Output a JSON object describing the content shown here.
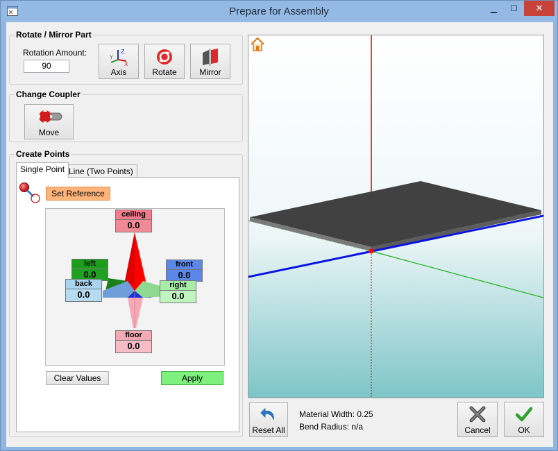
{
  "window": {
    "title": "Prepare for Assembly",
    "minimize_glyph": "▁",
    "maximize_glyph": "☐",
    "close_glyph": "✕"
  },
  "rotate_mirror": {
    "title": "Rotate / Mirror Part",
    "rotation_label": "Rotation Amount:",
    "rotation_value": "90",
    "axis_label": "Axis",
    "rotate_label": "Rotate",
    "mirror_label": "Mirror",
    "axis_letters": {
      "x": "X",
      "y": "Y",
      "z": "Z"
    }
  },
  "coupler": {
    "title": "Change Coupler",
    "move_label": "Move"
  },
  "create_points": {
    "title": "Create Points",
    "tabs": [
      {
        "label": "Single Point",
        "active": true
      },
      {
        "label": "Line (Two Points)",
        "active": false
      }
    ],
    "set_reference_label": "Set Reference",
    "directions": {
      "ceiling": {
        "label": "ceiling",
        "value": "0.0"
      },
      "left": {
        "label": "left",
        "value": "0.0"
      },
      "front": {
        "label": "front",
        "value": "0.0"
      },
      "back": {
        "label": "back",
        "value": "0.0"
      },
      "right": {
        "label": "right",
        "value": "0.0"
      },
      "floor": {
        "label": "floor",
        "value": "0.0"
      }
    },
    "clear_label": "Clear Values",
    "apply_label": "Apply"
  },
  "bottom": {
    "reset_label": "Reset All",
    "material_width": "Material Width: 0.25",
    "bend_radius": "Bend Radius: n/a",
    "cancel_label": "Cancel",
    "ok_label": "OK"
  },
  "colors": {
    "ceiling": "#ff0000",
    "floor": "#f4a9b4",
    "left": "#1c9e1c",
    "right": "#8fd88f",
    "front": "#1d2fd8",
    "back": "#6f9ed8",
    "apply": "#7ef07e",
    "set_reference": "#ffb47a"
  }
}
